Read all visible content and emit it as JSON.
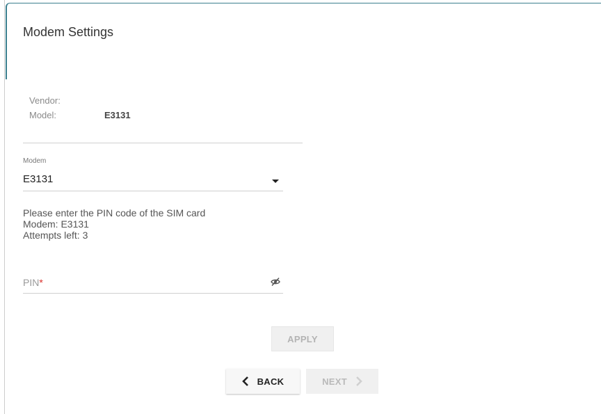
{
  "page": {
    "title": "Modem Settings"
  },
  "info": {
    "vendor_label": "Vendor:",
    "vendor_value": "",
    "model_label": "Model:",
    "model_value": "E3131"
  },
  "modem_select": {
    "label": "Modem",
    "value": "E3131",
    "icon": "chevron-down-icon"
  },
  "pin_message": {
    "line1": "Please enter the PIN code of the SIM card",
    "line2": "Modem: E3131",
    "line3": "Attempts left: 3"
  },
  "pin_field": {
    "label": "PIN",
    "required_mark": "*",
    "value": "",
    "icon": "eye-off-icon"
  },
  "buttons": {
    "apply": "APPLY",
    "back": "BACK",
    "next": "NEXT"
  },
  "colors": {
    "accent": "#3b7f8f",
    "required": "#d9302b",
    "disabled_text": "#b3b3b3"
  }
}
